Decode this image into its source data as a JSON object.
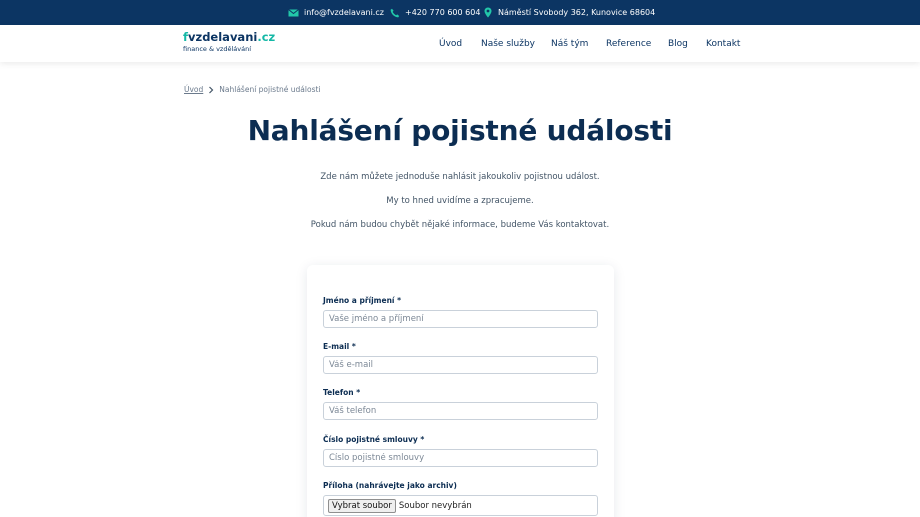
{
  "topbar": {
    "email": "info@fvzdelavani.cz",
    "phone": "+420 770 600 604",
    "address": "Náměstí Svobody 362, Kunovice 68604"
  },
  "logo": {
    "first": "f",
    "main": "vzdelavani",
    "tld": ".cz",
    "tagline": "finance & vzdělávání"
  },
  "nav": {
    "items": [
      "Úvod",
      "Naše služby",
      "Náš tým",
      "Reference",
      "Blog",
      "Kontakt"
    ]
  },
  "breadcrumb": {
    "home": "Úvod",
    "current": "Nahlášení pojistné události"
  },
  "page": {
    "title": "Nahlášení pojistné události",
    "intro": [
      "Zde nám můžete jednoduše nahlásit jakoukoliv pojistnou událost.",
      "My to hned uvidíme a zpracujeme.",
      "Pokud nám budou chybět nějaké informace, budeme Vás kontaktovat."
    ]
  },
  "form": {
    "name_label": "Jméno a příjmení *",
    "name_placeholder": "Vaše jméno a příjmení",
    "email_label": "E-mail *",
    "email_placeholder": "Váš e-mail",
    "phone_label": "Telefon *",
    "phone_placeholder": "Váš telefon",
    "policy_label": "Číslo pojistné smlouvy *",
    "policy_placeholder": "Číslo pojistné smlouvy",
    "attachment_label": "Příloha (nahrávejte jako archiv)",
    "file_button": "Vybrat soubor",
    "file_status": "Soubor nevybrán"
  },
  "colors": {
    "topbar": "#0c3563",
    "accent": "#14b8a6",
    "heading": "#0c2d52"
  }
}
